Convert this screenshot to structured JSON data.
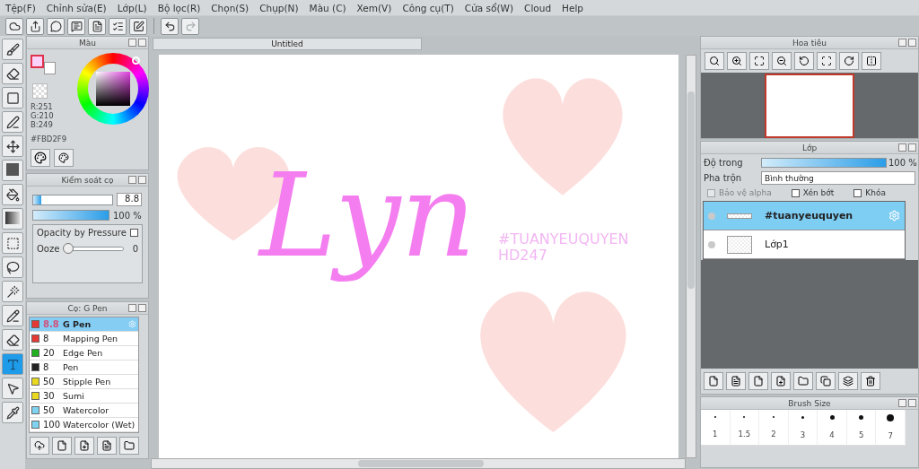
{
  "menu": [
    "Tệp(F)",
    "Chỉnh sửa(E)",
    "Lớp(L)",
    "Bộ lọc(R)",
    "Chọn(S)",
    "Chụp(N)",
    "Màu (C)",
    "Xem(V)",
    "Công cụ(T)",
    "Cửa sổ(W)",
    "Cloud",
    "Help"
  ],
  "history": {
    "undo_disabled": false,
    "redo_disabled": true
  },
  "tools": [
    {
      "kind": "brush",
      "selected": false
    },
    {
      "kind": "eraser",
      "selected": false
    },
    {
      "kind": "shape",
      "selected": false
    },
    {
      "kind": "dotline",
      "selected": false
    },
    {
      "kind": "move",
      "selected": false
    },
    {
      "kind": "fill",
      "selected": false
    },
    {
      "kind": "bucket",
      "selected": false
    },
    {
      "kind": "gradient",
      "selected": false
    },
    {
      "kind": "select",
      "selected": false
    },
    {
      "kind": "lasso",
      "selected": false
    },
    {
      "kind": "wand",
      "selected": false
    },
    {
      "kind": "selpen",
      "selected": false
    },
    {
      "kind": "selerase",
      "selected": false
    },
    {
      "kind": "text",
      "selected": true
    },
    {
      "kind": "operation",
      "selected": false
    },
    {
      "kind": "eyedropper",
      "selected": false
    }
  ],
  "color_panel": {
    "title": "Màu",
    "color": "#fbd2f9",
    "rgb": [
      "R:251",
      "G:210",
      "B:249"
    ],
    "hex": "#FBD2F9"
  },
  "brush_control": {
    "title": "Kiểm soát cọ",
    "size_slider": {
      "level": 0.1
    },
    "size": "8.8",
    "opacity_slider": {
      "level": 1
    },
    "opacity": "100 %",
    "pressure_label": "Opacity by Pressure",
    "pressure_checked": false,
    "ooze_label": "Ooze",
    "ooze_slider": {
      "level": 0
    },
    "ooze": "0"
  },
  "brushes": {
    "title": "Cọ: G Pen",
    "items": [
      {
        "size": "8.8",
        "name": "G Pen",
        "color": "#e53935",
        "selected": true
      },
      {
        "size": "8",
        "name": "Mapping Pen",
        "color": "#e53935",
        "selected": false
      },
      {
        "size": "20",
        "name": "Edge Pen",
        "color": "#22b022",
        "selected": false
      },
      {
        "size": "8",
        "name": "Pen",
        "color": "#222222",
        "selected": false
      },
      {
        "size": "50",
        "name": "Stipple Pen",
        "color": "#e8d820",
        "selected": false
      },
      {
        "size": "30",
        "name": "Sumi",
        "color": "#e8d820",
        "selected": false
      },
      {
        "size": "50",
        "name": "Watercolor",
        "color": "#7fd3f0",
        "selected": false
      },
      {
        "size": "100",
        "name": "Watercolor (Wet)",
        "color": "#7fd3f0",
        "selected": false
      }
    ]
  },
  "document": {
    "title": "Untitled",
    "lettering": "Lyn",
    "stamp_lines": [
      "#TUANYEUQUYEN",
      "HD247"
    ]
  },
  "navigator": {
    "title": "Hoa tiêu"
  },
  "layers": {
    "title": "Lớp",
    "opacity_label": "Độ trong",
    "opacity_slider": {
      "level": 1
    },
    "opacity": "100 %",
    "blend_label": "Pha trộn",
    "blend": "Bình thường",
    "options": [
      {
        "label": "Bảo vệ alpha",
        "checked": false,
        "disabled": true
      },
      {
        "label": "Xén bớt",
        "checked": false,
        "disabled": false
      },
      {
        "label": "Khóa",
        "checked": false,
        "disabled": false
      }
    ],
    "items": [
      {
        "name": "#tuanyeuquyen",
        "kind": "text",
        "selected": true
      },
      {
        "name": "Lớp1",
        "kind": "paint",
        "selected": false
      }
    ]
  },
  "brush_size": {
    "title": "Brush Size",
    "sizes": [
      "1",
      "1.5",
      "2",
      "3",
      "4",
      "5",
      "7"
    ]
  }
}
